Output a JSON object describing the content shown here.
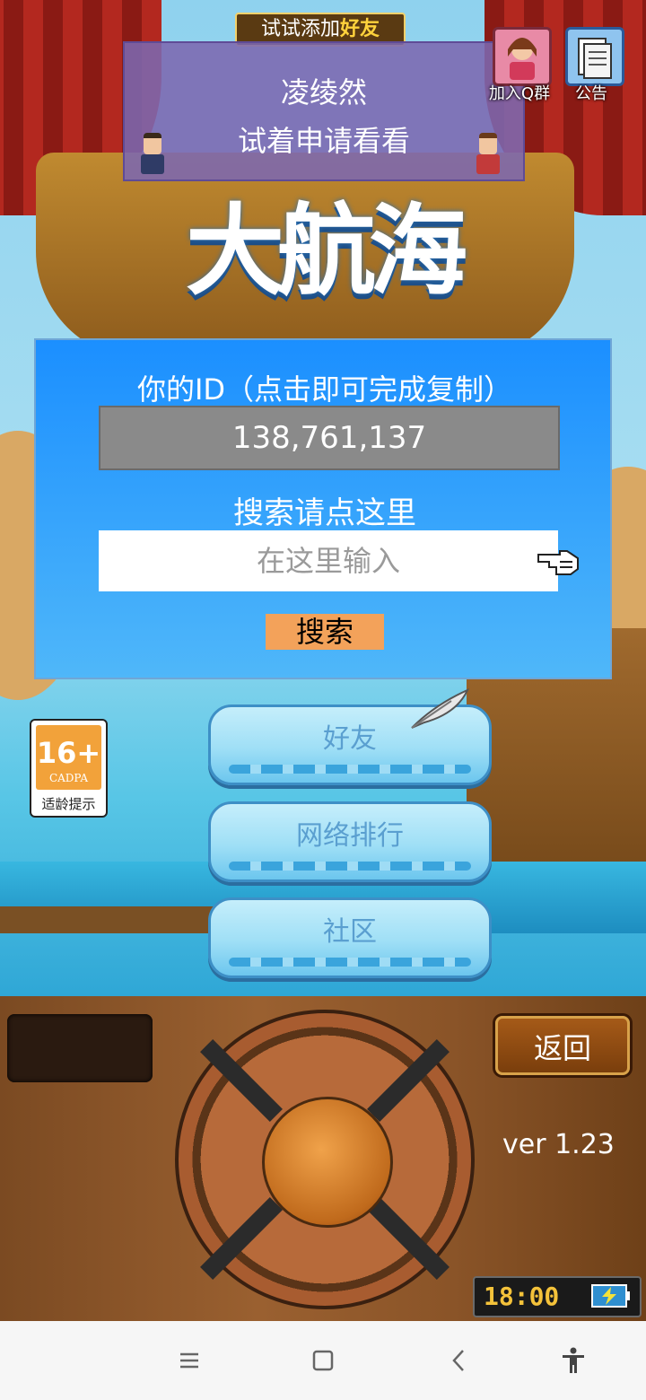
{
  "top": {
    "try_add_prefix": "试试添加",
    "try_add_highlight": "好友",
    "friend_name": "凌绫然",
    "friend_hint": "试着申请看看",
    "qgroup_label": "加入Q群",
    "notice_label": "公告"
  },
  "dialog": {
    "id_title": "你的ID（点击即可完成复制）",
    "id_value": "138,761,137",
    "search_title": "搜索请点这里",
    "search_placeholder": "在这里输入",
    "search_button": "搜索"
  },
  "menu": {
    "friends": "好友",
    "ranking": "网络排行",
    "community": "社区"
  },
  "age_rating": {
    "number": "16+",
    "org": "CADPA",
    "label": "适龄提示"
  },
  "panel": {
    "back": "返回",
    "version": "ver 1.23",
    "clock": "18:00"
  },
  "icons": {
    "qgroup": "qq-group-avatar-icon",
    "notice": "notice-document-icon",
    "pointer": "pointing-hand-icon",
    "quill": "quill-feather-icon",
    "battery": "battery-charging-icon"
  },
  "colors": {
    "dialog_blue": "#1b8fff",
    "search_button": "#f3a25a",
    "friend_panel": "#7c68b0",
    "clock_text": "#f4c23a"
  }
}
